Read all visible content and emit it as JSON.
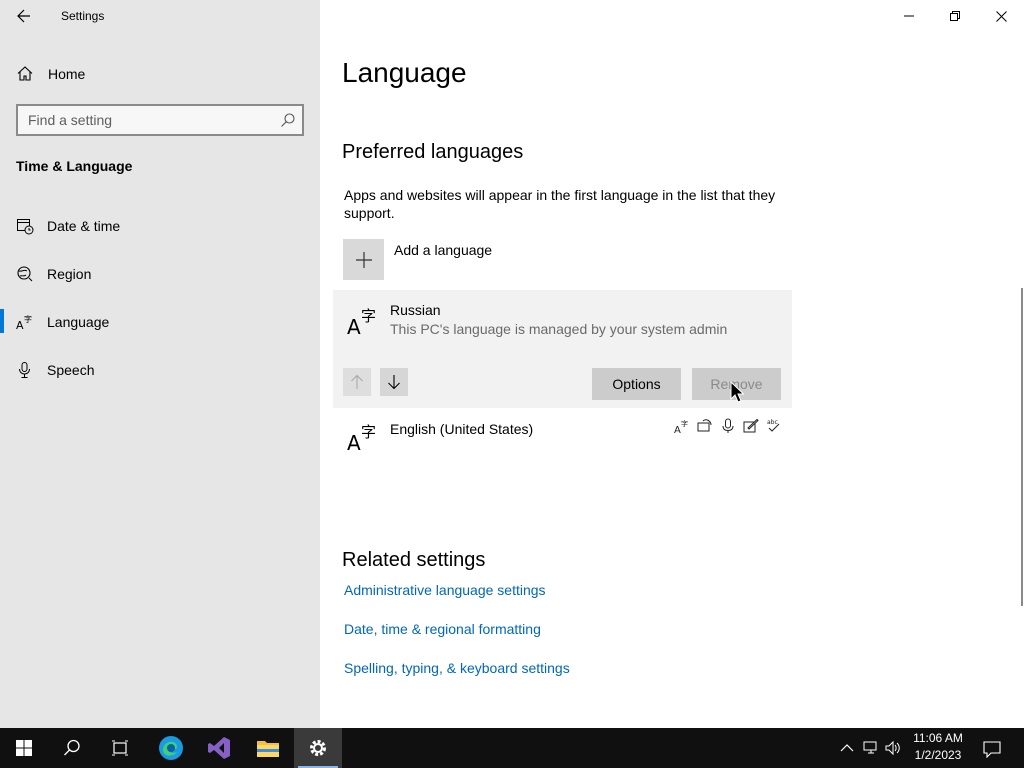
{
  "window": {
    "app_title": "Settings",
    "controls": [
      "minimize",
      "restore",
      "close"
    ]
  },
  "sidebar": {
    "home_label": "Home",
    "search_placeholder": "Find a setting",
    "section_title": "Time & Language",
    "items": [
      {
        "label": "Date & time",
        "icon": "date-time-icon",
        "selected": false
      },
      {
        "label": "Region",
        "icon": "globe-icon",
        "selected": false
      },
      {
        "label": "Language",
        "icon": "language-icon",
        "selected": true
      },
      {
        "label": "Speech",
        "icon": "microphone-icon",
        "selected": false
      }
    ],
    "accent_color": "#0078d7"
  },
  "main": {
    "page_title": "Language",
    "preferred": {
      "heading": "Preferred languages",
      "description": "Apps and websites will appear in the first language in the list that they support.",
      "add_label": "Add a language",
      "languages": [
        {
          "name": "Russian",
          "subtitle": "This PC's language is managed by your system admin",
          "expanded": true,
          "options_label": "Options",
          "remove_label": "Remove"
        },
        {
          "name": "English (United States)",
          "features": [
            "display-language-icon",
            "text-to-speech-icon",
            "speech-recognition-icon",
            "handwriting-icon",
            "spell-check-icon"
          ]
        }
      ]
    },
    "related": {
      "heading": "Related settings",
      "links": [
        "Administrative language settings",
        "Date, time & regional formatting",
        "Spelling, typing, & keyboard settings"
      ],
      "link_color": "#0067b8"
    }
  },
  "taskbar": {
    "apps": [
      "start-icon",
      "search-icon",
      "task-view-icon",
      "edge-icon",
      "visual-studio-icon",
      "file-explorer-icon",
      "settings-icon"
    ],
    "active_app": "settings-icon",
    "time": "11:06 AM",
    "date": "1/2/2023",
    "tray": [
      "chevron-up-icon",
      "network-icon",
      "volume-icon",
      "notification-icon"
    ]
  }
}
